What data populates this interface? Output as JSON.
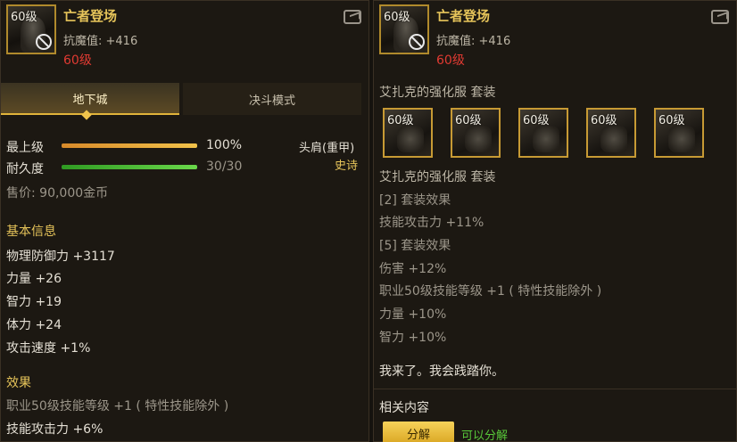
{
  "item": {
    "name": "亡者登场",
    "level_badge": "60级",
    "stat_line": "抗魔值: +416",
    "level_req": "60级"
  },
  "left": {
    "tabs": [
      {
        "label": "地下城",
        "active": true
      },
      {
        "label": "决斗模式",
        "active": false
      }
    ],
    "grade_label": "最上级",
    "grade_value": "100%",
    "grade_fill": 1.0,
    "durability_label": "耐久度",
    "durability_value": "30/30",
    "durability_fill": 1.0,
    "slot_type": "头肩(重甲)",
    "rarity": "史诗",
    "price": "售价: 90,000金币",
    "basic_info_title": "基本信息",
    "basic_stats": [
      "物理防御力 +3117",
      "力量 +26",
      "智力 +19",
      "体力 +24",
      "攻击速度 +1%"
    ],
    "effects_title": "效果",
    "effects": [
      "职业50级技能等级 +1 ( 特性技能除外 )",
      "技能攻击力 +6%"
    ]
  },
  "right": {
    "set_name": "艾扎克的强化服  套装",
    "set_slots": [
      {
        "level": "60级",
        "icon": "armor-icon"
      },
      {
        "level": "60级",
        "icon": "armor-icon"
      },
      {
        "level": "60级",
        "icon": "armor-icon"
      },
      {
        "level": "60级",
        "icon": "armor-icon"
      },
      {
        "level": "60级",
        "icon": "boots-icon"
      }
    ],
    "set_name_2": "艾扎克的强化服  套装",
    "set_lines": [
      "[2] 套装效果",
      "技能攻击力 +11%",
      "[5] 套装效果",
      "伤害 +12%",
      "职业50级技能等级 +1 ( 特性技能除外 )",
      "力量 +10%",
      "智力 +10%"
    ],
    "flavor": "我来了。我会践踏你。",
    "related_title": "相关内容",
    "decompose_button": "分解",
    "decompose_status": "可以分解"
  },
  "colors": {
    "gold": "#e6c45a",
    "red": "#e03a32",
    "green": "#58c83a",
    "bg": "#1c1812"
  }
}
